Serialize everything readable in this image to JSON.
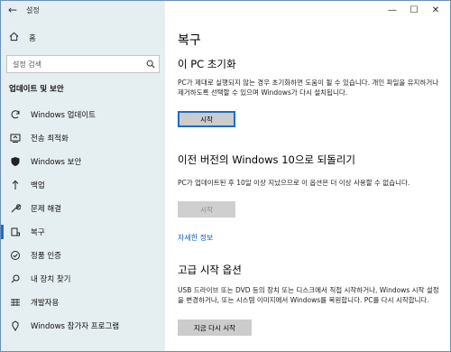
{
  "window": {
    "title": "설정"
  },
  "sidebar": {
    "home_label": "홈",
    "search_placeholder": "설정 검색",
    "section_title": "업데이트 및 보안",
    "items": [
      {
        "label": "Windows 업데이트",
        "icon": "refresh-icon"
      },
      {
        "label": "전송 최적화",
        "icon": "delivery-optimization-icon"
      },
      {
        "label": "Windows 보안",
        "icon": "shield-icon"
      },
      {
        "label": "백업",
        "icon": "backup-arrow-icon"
      },
      {
        "label": "문제 해결",
        "icon": "wrench-icon"
      },
      {
        "label": "복구",
        "icon": "recovery-icon",
        "active": true
      },
      {
        "label": "정품 인증",
        "icon": "activation-check-icon"
      },
      {
        "label": "내 장치 찾기",
        "icon": "find-device-icon"
      },
      {
        "label": "개발자용",
        "icon": "developer-icon"
      },
      {
        "label": "Windows 참가자 프로그램",
        "icon": "insider-icon"
      }
    ]
  },
  "main": {
    "title": "복구",
    "reset": {
      "heading": "이 PC 초기화",
      "description": "PC가 제대로 실행되지 않는 경우 초기화하면 도움이 될 수 있습니다. 개인 파일을 유지하거나 제거하도록 선택할 수 있으며 Windows가 다시 설치됩니다.",
      "button": "시작"
    },
    "rollback": {
      "heading": "이전 버전의 Windows 10으로 되돌리기",
      "description": "PC가 업데이트된 후 10일 이상 지났으므로 이 옵션은 더 이상 사용할 수 없습니다.",
      "button": "시작"
    },
    "more_info_link": "자세한 정보",
    "advanced": {
      "heading": "고급 시작 옵션",
      "description": "USB 드라이브 또는 DVD 등의 장치 또는 디스크에서 직접 시작하거나, Windows 시작 설정을 변경하거나, 또는 시스템 이미지에서 Windows를 복원합니다. PC를 다시 시작합니다.",
      "button": "지금 다시 시작"
    }
  },
  "colors": {
    "sidebar_bg": "#e5eef0",
    "accent": "#1e6fc8",
    "link": "#0a5db8"
  }
}
